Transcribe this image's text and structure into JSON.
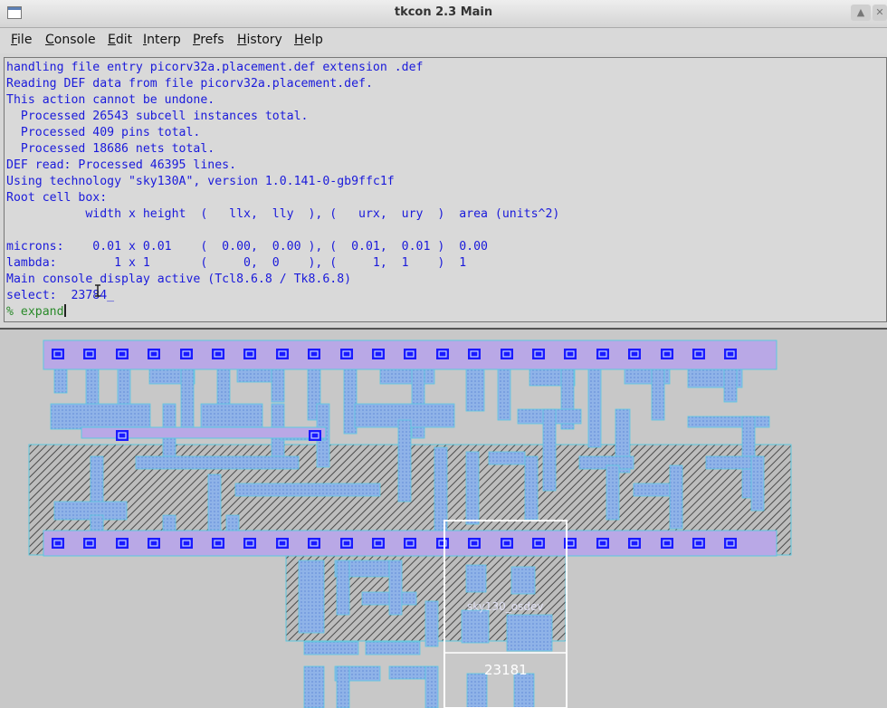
{
  "window": {
    "title": "tkcon 2.3 Main",
    "controls": [
      "chevron-up-icon",
      "close-icon"
    ]
  },
  "menubar": {
    "items": [
      {
        "label": "File",
        "mnemonic": "F",
        "rest": "ile"
      },
      {
        "label": "Console",
        "mnemonic": "C",
        "rest": "onsole"
      },
      {
        "label": "Edit",
        "mnemonic": "E",
        "rest": "dit"
      },
      {
        "label": "Interp",
        "mnemonic": "I",
        "rest": "nterp"
      },
      {
        "label": "Prefs",
        "mnemonic": "P",
        "rest": "refs"
      },
      {
        "label": "History",
        "mnemonic": "H",
        "rest": "istory"
      },
      {
        "label": "Help",
        "mnemonic": "H",
        "rest": "elp"
      }
    ]
  },
  "console": {
    "lines": [
      "handling file entry picorv32a.placement.def extension .def",
      "Reading DEF data from file picorv32a.placement.def.",
      "This action cannot be undone.",
      "  Processed 26543 subcell instances total.",
      "  Processed 409 pins total.",
      "  Processed 18686 nets total.",
      "DEF read: Processed 46395 lines.",
      "Using technology \"sky130A\", version 1.0.141-0-gb9ffc1f",
      "Root cell box:",
      "           width x height  (   llx,  lly  ), (   urx,  ury  )  area (units^2)",
      "",
      "microns:    0.01 x 0.01    (  0.00,  0.00 ), (  0.01,  0.01 )  0.00",
      "lambda:        1 x 1       (     0,  0    ), (     1,  1    )  1",
      "Main console display active (Tcl8.6.8 / Tk8.6.8)",
      "select:  23784_"
    ],
    "prompt_symbol": "%",
    "command": "expand"
  },
  "layout_view": {
    "cell_label": "sky130_osdev",
    "instance_label": "23181",
    "colors": {
      "background": "#c8c8c8",
      "metal": "#8fb3e8",
      "metal_edge": "#5bc8e0",
      "contact": "#1a1aff",
      "hatch": "#4a4a4a",
      "selection": "#ffffff",
      "rail": "#b9a8e6"
    }
  }
}
